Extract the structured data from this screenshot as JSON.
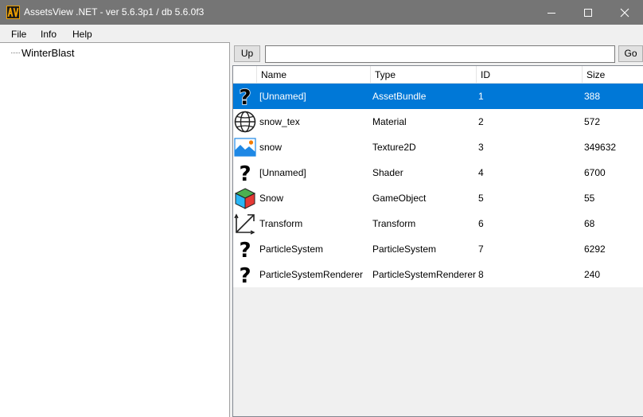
{
  "window": {
    "title": "AssetsView .NET - ver 5.6.3p1 / db 5.6.0f3",
    "app_icon": "av-logo-icon",
    "controls": [
      "minimize-icon",
      "maximize-icon",
      "close-icon"
    ]
  },
  "menu": {
    "file": "File",
    "info": "Info",
    "help": "Help"
  },
  "tree": {
    "root": "WinterBlast"
  },
  "toolbar": {
    "up_label": "Up",
    "path_value": "",
    "go_label": "Go"
  },
  "list": {
    "columns": [
      "Name",
      "Type",
      "ID",
      "Size"
    ],
    "rows": [
      {
        "icon": "question-icon",
        "name": "[Unnamed]",
        "type": "AssetBundle",
        "id": "1",
        "size": "388",
        "selected": true
      },
      {
        "icon": "globe-icon",
        "name": "snow_tex",
        "type": "Material",
        "id": "2",
        "size": "572"
      },
      {
        "icon": "image-icon",
        "name": "snow",
        "type": "Texture2D",
        "id": "3",
        "size": "349632"
      },
      {
        "icon": "question-icon",
        "name": "[Unnamed]",
        "type": "Shader",
        "id": "4",
        "size": "6700"
      },
      {
        "icon": "cube-icon",
        "name": "Snow",
        "type": "GameObject",
        "id": "5",
        "size": "55"
      },
      {
        "icon": "transform-arrows-icon",
        "name": "Transform",
        "type": "Transform",
        "id": "6",
        "size": "68"
      },
      {
        "icon": "question-icon",
        "name": "ParticleSystem",
        "type": "ParticleSystem",
        "id": "7",
        "size": "6292"
      },
      {
        "icon": "question-icon",
        "name": "ParticleSystemRenderer",
        "type": "ParticleSystemRenderer",
        "id": "8",
        "size": "240"
      }
    ]
  },
  "colors": {
    "titlebar": "#757575",
    "selection": "#0078d7",
    "logo": "#f0a000"
  }
}
